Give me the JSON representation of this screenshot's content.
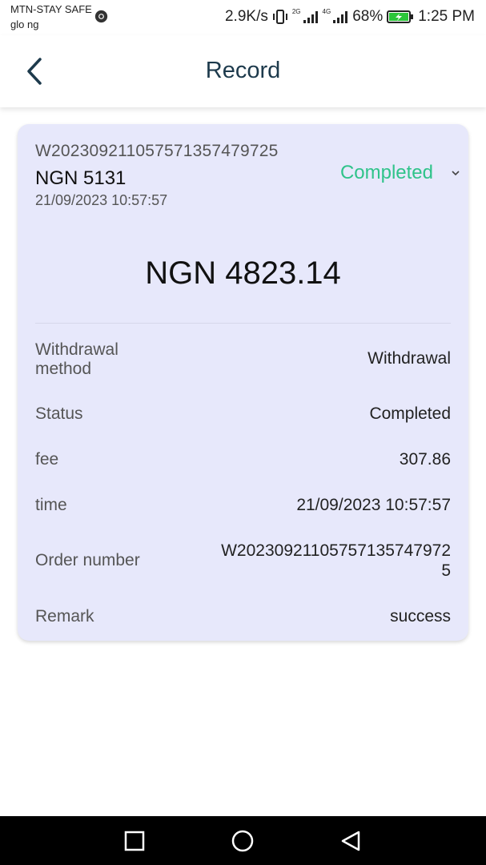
{
  "status_bar": {
    "carrier_primary": "MTN-STAY SAFE",
    "carrier_secondary": "glo ng",
    "network_speed": "2.9K/s",
    "network_type_1": "2G",
    "network_type_2": "4G",
    "battery_percent": "68%",
    "time": "1:25 PM"
  },
  "header": {
    "title": "Record",
    "back_icon": "chevron-left-icon"
  },
  "record": {
    "order_id": "W20230921105757135747972​5",
    "order_id_display": "W2023092110575713574797​25",
    "amount": "NGN 5131",
    "date": "21/09/2023 10:57:57",
    "status": "Completed",
    "status_color": "#2fc38a",
    "expand_icon": "chevron-down-icon",
    "total": "NGN 4823.14",
    "details": {
      "method_label": "Withdrawal method",
      "method_value": "Withdrawal",
      "status_label": "Status",
      "status_value": "Completed",
      "fee_label": "fee",
      "fee_value": "307.86",
      "time_label": "time",
      "time_value": "21/09/2023 10:57:57",
      "order_label": "Order number",
      "order_value_line1": "W2023092110575713574797​2",
      "order_value_line2": "5",
      "remark_label": "Remark",
      "remark_value": "success"
    }
  },
  "nav_bar": {
    "recent_icon": "square-icon",
    "home_icon": "circle-icon",
    "back_icon": "triangle-back-icon"
  },
  "colors": {
    "card_background": "#e7e8fb",
    "title_color": "#1d3a4c",
    "status_green": "#2fc38a"
  }
}
